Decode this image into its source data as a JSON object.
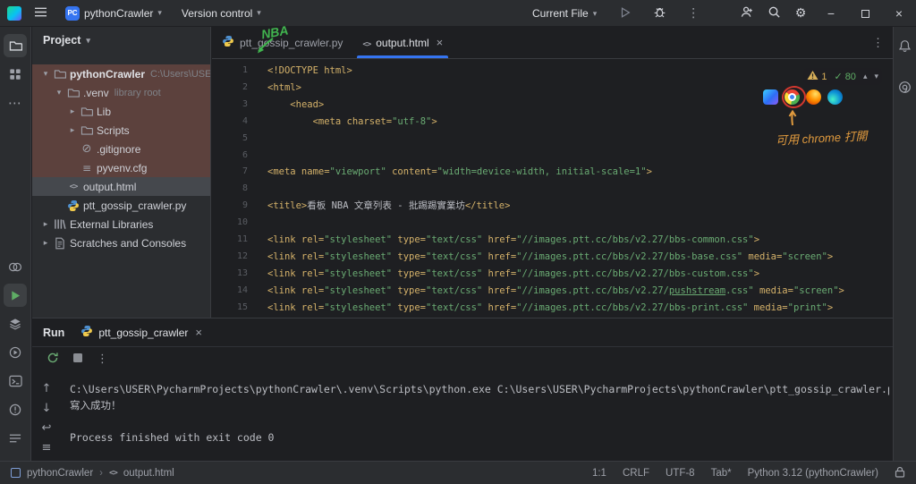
{
  "colors": {
    "accent": "#3574f0",
    "tag_gold": "#d5b26a",
    "string_green": "#6aab73",
    "warning_yellow": "#d6ae58",
    "run_green": "#5fad65",
    "annotation_green": "#41b54f",
    "annotation_orange": "#e09a3e",
    "annotation_red": "#d3382f",
    "tree_highlight_red": "#5c413d",
    "tree_highlight_gray": "#45484d"
  },
  "glyphs": {
    "kebab": "⋮",
    "ellipsis": "⋯",
    "chevron_down": "▾",
    "chevron_right": "▸",
    "chevron_up": "▴",
    "close": "×",
    "minimize": "−",
    "check": "✓",
    "gear": "⚙",
    "arrow_up": "↑",
    "arrow_down": "↓",
    "soft_wrap": "↩",
    "clear": "≡"
  },
  "title_bar": {
    "project_chip": "PC",
    "project_name": "pythonCrawler",
    "vcs_widget": "Version control",
    "run_config": "Current File"
  },
  "left_strip": {
    "top": [
      {
        "name": "project",
        "icon": "folder-active",
        "active": true
      },
      {
        "name": "structure",
        "icon": "grid",
        "active": false
      },
      {
        "name": "more-tool-windows",
        "icon": "more",
        "active": false
      }
    ],
    "bottom": [
      {
        "name": "python-packages",
        "icon": "rings",
        "active": false
      },
      {
        "name": "run",
        "icon": "play-green",
        "active": true
      },
      {
        "name": "services",
        "icon": "layers",
        "active": false
      },
      {
        "name": "python-console",
        "icon": "circle-play",
        "active": false
      },
      {
        "name": "terminal",
        "icon": "terminal",
        "active": false
      },
      {
        "name": "problems",
        "icon": "bang-circle",
        "active": false
      },
      {
        "name": "todo",
        "icon": "lines",
        "active": false
      }
    ]
  },
  "right_strip": [
    {
      "name": "notifications",
      "icon": "bell"
    },
    {
      "name": "ai-assistant",
      "icon": "ai"
    }
  ],
  "project_panel": {
    "header_label": "Project",
    "items": [
      {
        "label": "pythonCrawler",
        "annex": "C:\\Users\\USER\\P",
        "depth": 0,
        "icon": "folder",
        "chevron": "down",
        "hl": "red",
        "bold": true
      },
      {
        "label": ".venv",
        "annex": "library root",
        "depth": 1,
        "icon": "folder",
        "chevron": "down",
        "hl": "red"
      },
      {
        "label": "Lib",
        "depth": 2,
        "icon": "folder",
        "chevron": "right",
        "hl": "red"
      },
      {
        "label": "Scripts",
        "depth": 2,
        "icon": "folder",
        "chevron": "right",
        "hl": "red"
      },
      {
        "label": ".gitignore",
        "depth": 2,
        "icon": "ignore",
        "hl": "red"
      },
      {
        "label": "pyvenv.cfg",
        "depth": 2,
        "icon": "config",
        "hl": "red"
      },
      {
        "label": "output.html",
        "depth": 1,
        "icon": "html",
        "hl": "gray"
      },
      {
        "label": "ptt_gossip_crawler.py",
        "depth": 1,
        "icon": "python"
      },
      {
        "label": "External Libraries",
        "depth": 0,
        "icon": "library",
        "chevron": "right"
      },
      {
        "label": "Scratches and Consoles",
        "depth": 0,
        "icon": "scratch",
        "chevron": "right"
      }
    ]
  },
  "editor": {
    "tabs": [
      {
        "label": "ptt_gossip_crawler.py",
        "icon": "python",
        "active": false
      },
      {
        "label": "output.html",
        "icon": "html",
        "active": true
      }
    ],
    "inspection": {
      "warnings": "1",
      "ok": "80"
    },
    "browsers": [
      "builtin-preview",
      "chrome",
      "firefox",
      "edge"
    ],
    "annotations": {
      "tab_note": "NBA",
      "browser_note": "可用 chrome 打開"
    },
    "code_lines": [
      [
        [
          "tag",
          "<!DOCTYPE html>"
        ]
      ],
      [
        [
          "tag",
          "<html>"
        ]
      ],
      [
        [
          "txt",
          "    "
        ],
        [
          "tag",
          "<head>"
        ]
      ],
      [
        [
          "txt",
          "        "
        ],
        [
          "tag",
          "<meta charset="
        ],
        [
          "str",
          "\"utf-8\""
        ],
        [
          "tag",
          ">"
        ]
      ],
      [],
      [],
      [
        [
          "tag",
          "<meta name="
        ],
        [
          "str",
          "\"viewport\""
        ],
        [
          "tag",
          " content="
        ],
        [
          "str",
          "\"width=device-width, initial-scale=1\""
        ],
        [
          "tag",
          ">"
        ]
      ],
      [],
      [
        [
          "tag",
          "<title>"
        ],
        [
          "txt",
          "看板 NBA 文章列表 - 批踢踢實業坊"
        ],
        [
          "tag",
          "</title>"
        ]
      ],
      [],
      [
        [
          "tag",
          "<link rel="
        ],
        [
          "str",
          "\"stylesheet\""
        ],
        [
          "tag",
          " type="
        ],
        [
          "str",
          "\"text/css\""
        ],
        [
          "tag",
          " href="
        ],
        [
          "str",
          "\"//images.ptt.cc/bbs/v2.27/bbs-common.css\""
        ],
        [
          "tag",
          ">"
        ]
      ],
      [
        [
          "tag",
          "<link rel="
        ],
        [
          "str",
          "\"stylesheet\""
        ],
        [
          "tag",
          " type="
        ],
        [
          "str",
          "\"text/css\""
        ],
        [
          "tag",
          " href="
        ],
        [
          "str",
          "\"//images.ptt.cc/bbs/v2.27/bbs-base.css\""
        ],
        [
          "tag",
          " media="
        ],
        [
          "str",
          "\"screen\""
        ],
        [
          "tag",
          ">"
        ]
      ],
      [
        [
          "tag",
          "<link rel="
        ],
        [
          "str",
          "\"stylesheet\""
        ],
        [
          "tag",
          " type="
        ],
        [
          "str",
          "\"text/css\""
        ],
        [
          "tag",
          " href="
        ],
        [
          "str",
          "\"//images.ptt.cc/bbs/v2.27/bbs-custom.css\""
        ],
        [
          "tag",
          ">"
        ]
      ],
      [
        [
          "tag",
          "<link rel="
        ],
        [
          "str",
          "\"stylesheet\""
        ],
        [
          "tag",
          " type="
        ],
        [
          "str",
          "\"text/css\""
        ],
        [
          "tag",
          " href="
        ],
        [
          "str",
          "\"//images.ptt.cc/bbs/v2.27/"
        ],
        [
          "strU",
          "pushstream"
        ],
        [
          "str",
          ".css\""
        ],
        [
          "tag",
          " media="
        ],
        [
          "str",
          "\"screen\""
        ],
        [
          "tag",
          ">"
        ]
      ],
      [
        [
          "tag",
          "<link rel="
        ],
        [
          "str",
          "\"stylesheet\""
        ],
        [
          "tag",
          " type="
        ],
        [
          "str",
          "\"text/css\""
        ],
        [
          "tag",
          " href="
        ],
        [
          "str",
          "\"//images.ptt.cc/bbs/v2.27/bbs-print.css\""
        ],
        [
          "tag",
          " media="
        ],
        [
          "str",
          "\"print\""
        ],
        [
          "tag",
          ">"
        ]
      ]
    ]
  },
  "run_panel": {
    "title": "Run",
    "tab": {
      "label": "ptt_gossip_crawler",
      "icon": "python"
    },
    "rail": [
      {
        "name": "prev-occurrence",
        "glyph": "↑"
      },
      {
        "name": "next-occurrence",
        "glyph": "↓"
      },
      {
        "name": "soft-wrap",
        "glyph": "↩"
      },
      {
        "name": "clear-all",
        "glyph": "≡"
      }
    ],
    "console": [
      "C:\\Users\\USER\\PycharmProjects\\pythonCrawler\\.venv\\Scripts\\python.exe C:\\Users\\USER\\PycharmProjects\\pythonCrawler\\ptt_gossip_crawler.py",
      "寫入成功！",
      "",
      "Process finished with exit code 0"
    ]
  },
  "status_bar": {
    "project": "pythonCrawler",
    "separator": "›",
    "file_icon": "<>",
    "file": "output.html",
    "items": [
      "1:1",
      "CRLF",
      "UTF-8",
      "Tab*",
      "Python 3.12 (pythonCrawler)"
    ]
  }
}
